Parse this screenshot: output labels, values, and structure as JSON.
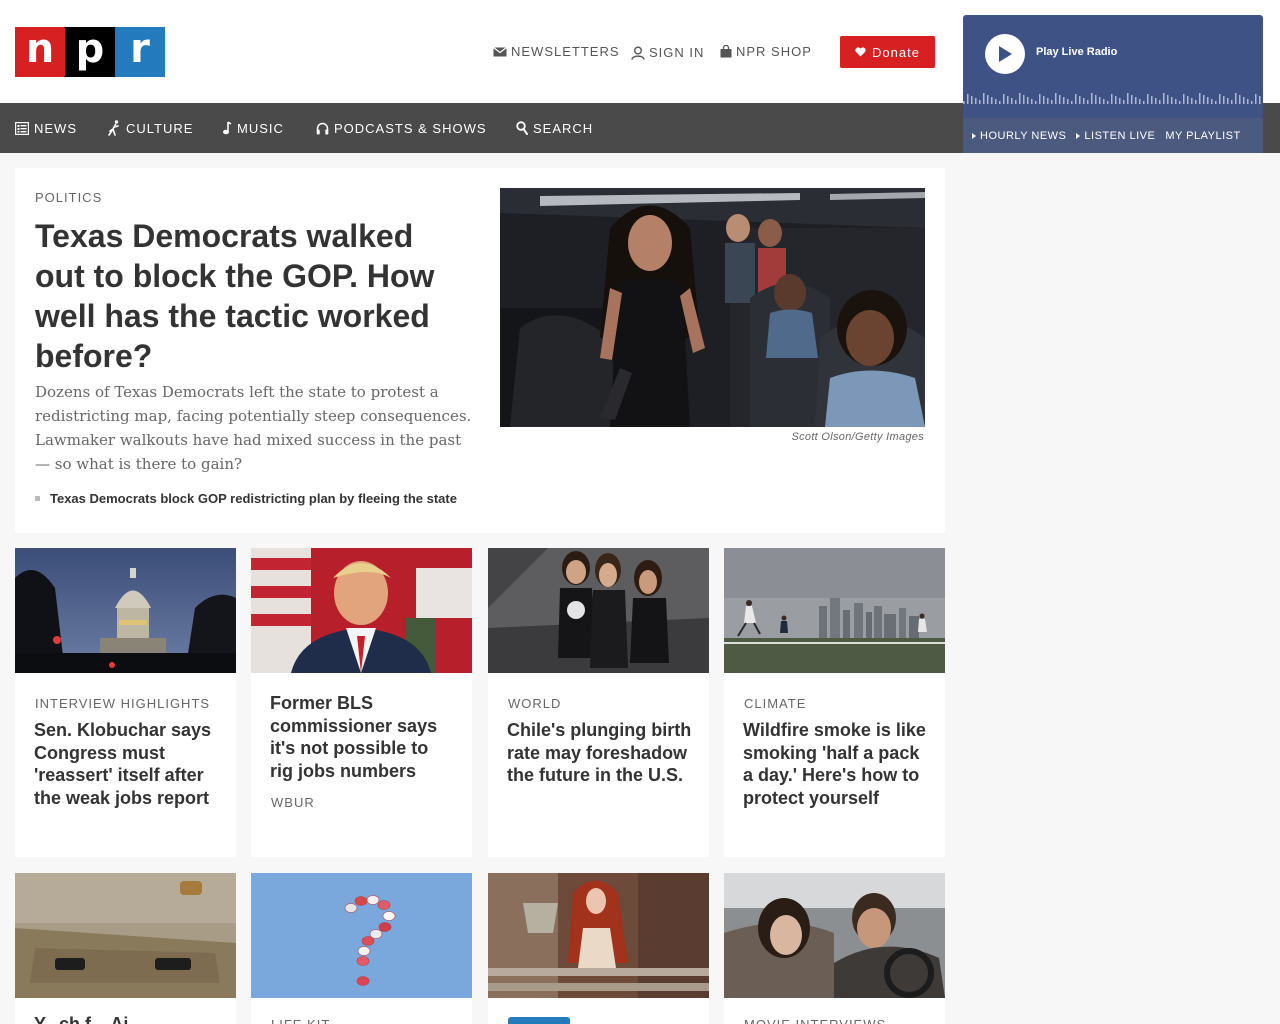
{
  "brand": {
    "letters": [
      "n",
      "p",
      "r"
    ],
    "colors": {
      "red": "#d62021",
      "black": "#000000",
      "blue": "#237bbd"
    }
  },
  "utility": {
    "newsletters": "Newsletters",
    "sign_in": "Sign In",
    "shop": "NPR Shop",
    "donate": "Donate"
  },
  "player": {
    "play_label": "Play Live Radio",
    "links": [
      "Hourly News",
      "Listen Live",
      "My Playlist"
    ]
  },
  "nav": {
    "items": [
      "News",
      "Culture",
      "Music",
      "Podcasts & Shows",
      "Search"
    ]
  },
  "hero": {
    "slug": "Politics",
    "title": "Texas Democrats walked out to block the GOP. How well has the tactic worked before?",
    "teaser": "Dozens of Texas Democrats left the state to protest a redistricting map, facing potentially steep consequences. Lawmaker walkouts have had mixed success in the past — so what is there to gain?",
    "related": "Texas Democrats block GOP redistricting plan by fleeing the state",
    "credit": "Scott Olson/Getty Images"
  },
  "cards_row1": [
    {
      "slug": "Interview Highlights",
      "title": "Sen. Klobuchar says Congress must 'reassert' itself after the weak jobs report",
      "source": ""
    },
    {
      "slug": "",
      "title": "Former BLS commissioner says it's not possible to rig jobs numbers",
      "source": "WBUR"
    },
    {
      "slug": "World",
      "title": "Chile's plunging birth rate may foreshadow the future in the U.S.",
      "source": ""
    },
    {
      "slug": "Climate",
      "title": "Wildfire smoke is like smoking 'half a pack a day.' Here's how to protect yourself",
      "source": ""
    }
  ],
  "cards_row2": [
    {
      "slug": "",
      "title": "Y...ch f... Ai..."
    },
    {
      "slug": "Life Kit",
      "title": ""
    },
    {
      "slug": "",
      "title": ""
    },
    {
      "slug": "Movie Interviews",
      "title": ""
    }
  ]
}
